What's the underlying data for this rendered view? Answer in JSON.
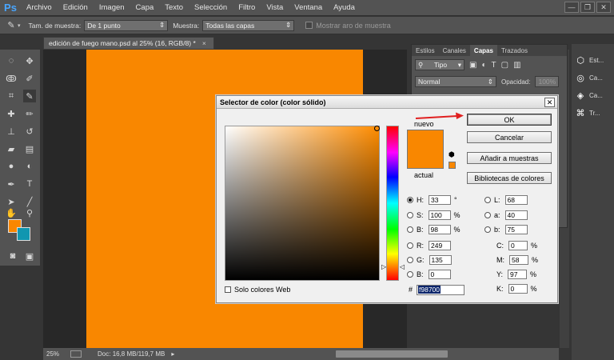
{
  "app": {
    "logo": "Ps"
  },
  "menubar": {
    "items": [
      "Archivo",
      "Edición",
      "Imagen",
      "Capa",
      "Texto",
      "Selección",
      "Filtro",
      "Vista",
      "Ventana",
      "Ayuda"
    ],
    "window_controls": [
      "—",
      "❐",
      "✕"
    ]
  },
  "options_bar": {
    "sample_size_label": "Tam. de muestra:",
    "sample_size_value": "De 1 punto",
    "sample_label": "Muestra:",
    "sample_value": "Todas las capas",
    "show_ring_label": "Mostrar aro de muestra"
  },
  "document": {
    "tab_title": "edición de fuego mano.psd al 25% (16, RGB/8) *",
    "tab_close": "×",
    "zoom": "25%",
    "doc_info": "Doc: 16,8 MB/119,7 MB"
  },
  "panels": {
    "tabs": [
      "Estilos",
      "Canales",
      "Capas",
      "Trazados"
    ],
    "active_tab": "Capas",
    "filter_label": "Tipo",
    "blend_mode": "Normal",
    "opacity_label": "Opacidad:",
    "opacity_value": "100%"
  },
  "dock": {
    "items": [
      "Est...",
      "Ca...",
      "Ca...",
      "Tr..."
    ]
  },
  "color_picker": {
    "title": "Selector de color (color sólido)",
    "new_label": "nuevo",
    "current_label": "actual",
    "ok_label": "OK",
    "cancel_label": "Cancelar",
    "add_swatches_label": "Añadir a muestras",
    "libraries_label": "Bibliotecas de colores",
    "web_only_label": "Solo colores Web",
    "hex_label": "#",
    "hex_value": "f98700",
    "hsb": [
      {
        "label": "H:",
        "value": "33",
        "unit": "°",
        "selected": true
      },
      {
        "label": "S:",
        "value": "100",
        "unit": "%",
        "selected": false
      },
      {
        "label": "B:",
        "value": "98",
        "unit": "%",
        "selected": false
      }
    ],
    "rgb": [
      {
        "label": "R:",
        "value": "249"
      },
      {
        "label": "G:",
        "value": "135"
      },
      {
        "label": "B:",
        "value": "0"
      }
    ],
    "lab": [
      {
        "label": "L:",
        "value": "68"
      },
      {
        "label": "a:",
        "value": "40"
      },
      {
        "label": "b:",
        "value": "75"
      }
    ],
    "cmyk": [
      {
        "label": "C:",
        "value": "0",
        "unit": "%"
      },
      {
        "label": "M:",
        "value": "58",
        "unit": "%"
      },
      {
        "label": "Y:",
        "value": "97",
        "unit": "%"
      },
      {
        "label": "K:",
        "value": "0",
        "unit": "%"
      }
    ]
  },
  "colors": {
    "foreground": "#f98700",
    "background": "#1196b0",
    "annotation_arrow": "#e02020"
  }
}
